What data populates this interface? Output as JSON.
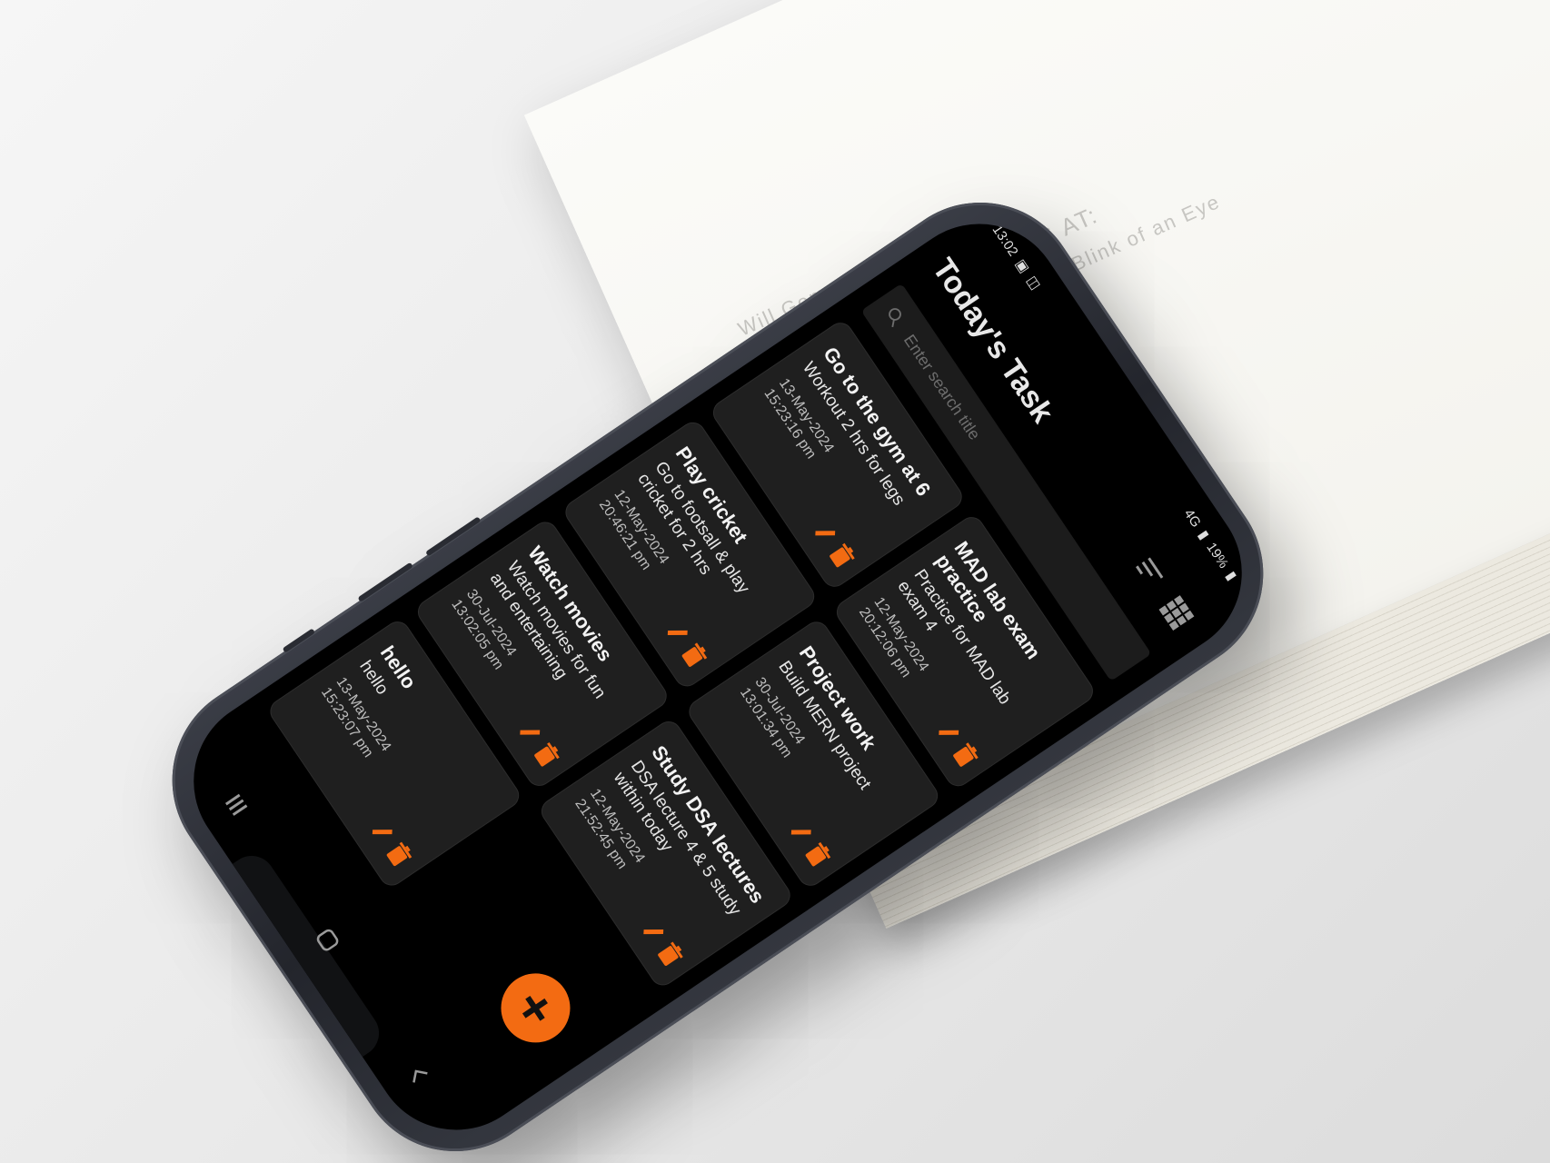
{
  "book": {
    "author": "Will Gompertz",
    "title": "WHAT ARE YOU LOOKING AT:",
    "subtitle": "150 Years of Modern Art in the Blink of an Eye"
  },
  "status_bar": {
    "time": "13:02",
    "network": "4G",
    "battery": "19%"
  },
  "header": {
    "title": "Today's Task"
  },
  "search": {
    "placeholder": "Enter search title"
  },
  "colors": {
    "accent": "#f36b12",
    "card_bg": "#1f1f1f",
    "screen_bg": "#000000"
  },
  "tasks": [
    {
      "title": "Go to the gym at 6",
      "description": "Workout 2 hrs for legs",
      "date": "13-May-2024 15:23:16 pm"
    },
    {
      "title": "MAD lab exam practice",
      "description": "Practice for MAD lab exam 4",
      "date": "12-May-2024 20:12:06 pm"
    },
    {
      "title": "Play cricket",
      "description": "Go to footsall & play cricket for 2 hrs",
      "date": "12-May-2024 20:46:21 pm"
    },
    {
      "title": "Project work",
      "description": "Build MERN project",
      "date": "30-Jul-2024 13:01:34 pm"
    },
    {
      "title": "Watch movies",
      "description": "Watch movies for fun and entertaining",
      "date": "30-Jul-2024 13:02:05 pm"
    },
    {
      "title": "Study DSA lectures",
      "description": "DSA lecture 4 & 5 study within today",
      "date": "12-May-2024 21:52:45 pm"
    },
    {
      "title": "hello",
      "description": "hello",
      "date": "13-May-2024 15:23:07 pm"
    }
  ],
  "fab": {
    "label": "+"
  }
}
